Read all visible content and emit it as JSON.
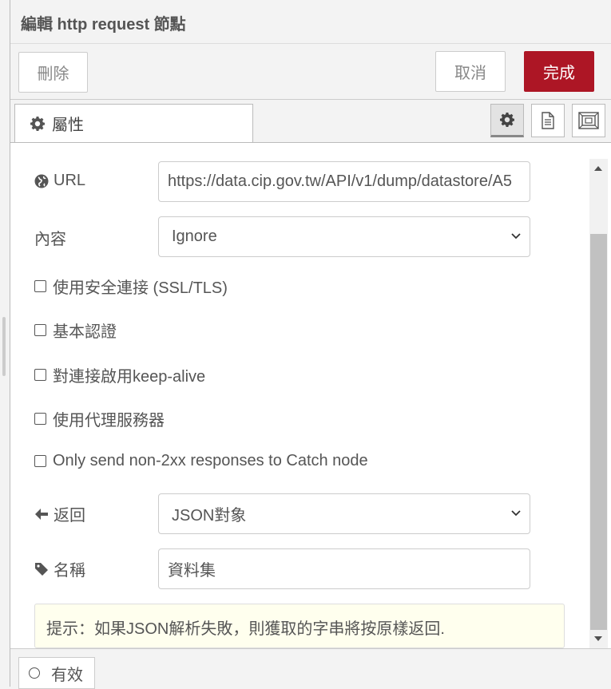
{
  "header": {
    "title": "編輯 http request 節點"
  },
  "actions": {
    "delete_label": "刪除",
    "cancel_label": "取消",
    "done_label": "完成"
  },
  "tabs": {
    "properties_label": "屬性"
  },
  "tab_icons": [
    "settings-icon",
    "description-icon",
    "appearance-icon"
  ],
  "form": {
    "url": {
      "label": "URL",
      "value": "https://data.cip.gov.tw/API/v1/dump/datastore/A5"
    },
    "method": {
      "label": "內容",
      "value": "Ignore"
    },
    "options": [
      {
        "label": "使用安全連接 (SSL/TLS)",
        "checked": false
      },
      {
        "label": "基本認證",
        "checked": false
      },
      {
        "label": "對連接啟用keep-alive",
        "checked": false
      },
      {
        "label": "使用代理服務器",
        "checked": false
      },
      {
        "label": "Only send non-2xx responses to Catch node",
        "checked": false
      }
    ],
    "ret": {
      "label": "返回",
      "value": "JSON對象"
    },
    "name": {
      "label": "名稱",
      "value": "資料集"
    }
  },
  "tip": "提示：如果JSON解析失敗，則獲取的字串將按原樣返回.",
  "footer": {
    "enabled_label": "有效"
  }
}
